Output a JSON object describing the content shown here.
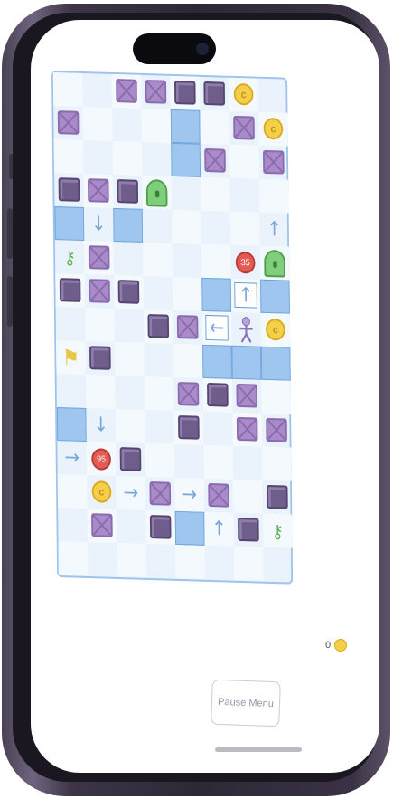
{
  "game": {
    "cols": 8,
    "rows": 15,
    "tiles": [
      {
        "r": 0,
        "c": 2,
        "type": "crate"
      },
      {
        "r": 0,
        "c": 3,
        "type": "crate"
      },
      {
        "r": 0,
        "c": 4,
        "type": "block"
      },
      {
        "r": 0,
        "c": 5,
        "type": "block"
      },
      {
        "r": 0,
        "c": 6,
        "type": "coin"
      },
      {
        "r": 1,
        "c": 0,
        "type": "crate"
      },
      {
        "r": 1,
        "c": 4,
        "type": "panel"
      },
      {
        "r": 1,
        "c": 6,
        "type": "crate"
      },
      {
        "r": 1,
        "c": 7,
        "type": "coin"
      },
      {
        "r": 2,
        "c": 4,
        "type": "panel"
      },
      {
        "r": 2,
        "c": 5,
        "type": "crate"
      },
      {
        "r": 2,
        "c": 7,
        "type": "crate"
      },
      {
        "r": 3,
        "c": 0,
        "type": "block"
      },
      {
        "r": 3,
        "c": 1,
        "type": "crate"
      },
      {
        "r": 3,
        "c": 2,
        "type": "block"
      },
      {
        "r": 3,
        "c": 3,
        "type": "door"
      },
      {
        "r": 4,
        "c": 0,
        "type": "panel"
      },
      {
        "r": 4,
        "c": 1,
        "type": "arrow",
        "dir": "down"
      },
      {
        "r": 4,
        "c": 2,
        "type": "panel"
      },
      {
        "r": 4,
        "c": 7,
        "type": "arrow",
        "dir": "up"
      },
      {
        "r": 5,
        "c": 0,
        "type": "key"
      },
      {
        "r": 5,
        "c": 1,
        "type": "crate"
      },
      {
        "r": 5,
        "c": 6,
        "type": "bomb",
        "value": "35"
      },
      {
        "r": 5,
        "c": 7,
        "type": "door"
      },
      {
        "r": 6,
        "c": 0,
        "type": "block"
      },
      {
        "r": 6,
        "c": 1,
        "type": "crate"
      },
      {
        "r": 6,
        "c": 2,
        "type": "block"
      },
      {
        "r": 6,
        "c": 5,
        "type": "panel"
      },
      {
        "r": 6,
        "c": 6,
        "type": "arrow",
        "dir": "up",
        "boxed": true
      },
      {
        "r": 6,
        "c": 7,
        "type": "panel"
      },
      {
        "r": 7,
        "c": 3,
        "type": "block"
      },
      {
        "r": 7,
        "c": 4,
        "type": "crate"
      },
      {
        "r": 7,
        "c": 5,
        "type": "arrow",
        "dir": "left",
        "boxed": true
      },
      {
        "r": 7,
        "c": 6,
        "type": "player"
      },
      {
        "r": 7,
        "c": 7,
        "type": "coin"
      },
      {
        "r": 8,
        "c": 0,
        "type": "flag"
      },
      {
        "r": 8,
        "c": 1,
        "type": "block"
      },
      {
        "r": 8,
        "c": 5,
        "type": "panel"
      },
      {
        "r": 8,
        "c": 6,
        "type": "panel"
      },
      {
        "r": 8,
        "c": 7,
        "type": "panel"
      },
      {
        "r": 9,
        "c": 4,
        "type": "crate"
      },
      {
        "r": 9,
        "c": 5,
        "type": "block"
      },
      {
        "r": 9,
        "c": 6,
        "type": "crate"
      },
      {
        "r": 10,
        "c": 0,
        "type": "panel"
      },
      {
        "r": 10,
        "c": 1,
        "type": "arrow",
        "dir": "down"
      },
      {
        "r": 10,
        "c": 4,
        "type": "block"
      },
      {
        "r": 10,
        "c": 6,
        "type": "crate"
      },
      {
        "r": 10,
        "c": 7,
        "type": "crate"
      },
      {
        "r": 11,
        "c": 0,
        "type": "arrow",
        "dir": "right"
      },
      {
        "r": 11,
        "c": 1,
        "type": "bomb",
        "value": "95"
      },
      {
        "r": 11,
        "c": 2,
        "type": "block"
      },
      {
        "r": 12,
        "c": 1,
        "type": "coin"
      },
      {
        "r": 12,
        "c": 2,
        "type": "arrow",
        "dir": "right"
      },
      {
        "r": 12,
        "c": 3,
        "type": "crate"
      },
      {
        "r": 12,
        "c": 4,
        "type": "arrow",
        "dir": "right"
      },
      {
        "r": 12,
        "c": 5,
        "type": "crate"
      },
      {
        "r": 12,
        "c": 7,
        "type": "block"
      },
      {
        "r": 13,
        "c": 1,
        "type": "crate"
      },
      {
        "r": 13,
        "c": 3,
        "type": "block"
      },
      {
        "r": 13,
        "c": 4,
        "type": "panel"
      },
      {
        "r": 13,
        "c": 5,
        "type": "arrow",
        "dir": "up"
      },
      {
        "r": 13,
        "c": 6,
        "type": "block"
      },
      {
        "r": 13,
        "c": 7,
        "type": "key"
      }
    ]
  },
  "hud": {
    "coin_count": "0",
    "pause_label": "Pause Menu"
  },
  "colors": {
    "crate": "#a88bc8",
    "block": "#6f5e8c",
    "panel": "#9fc6ef",
    "coin": "#f3cf4a",
    "door": "#7fcf7a",
    "bomb": "#e25b55",
    "key": "#5fb254",
    "flag": "#e8c64a"
  }
}
